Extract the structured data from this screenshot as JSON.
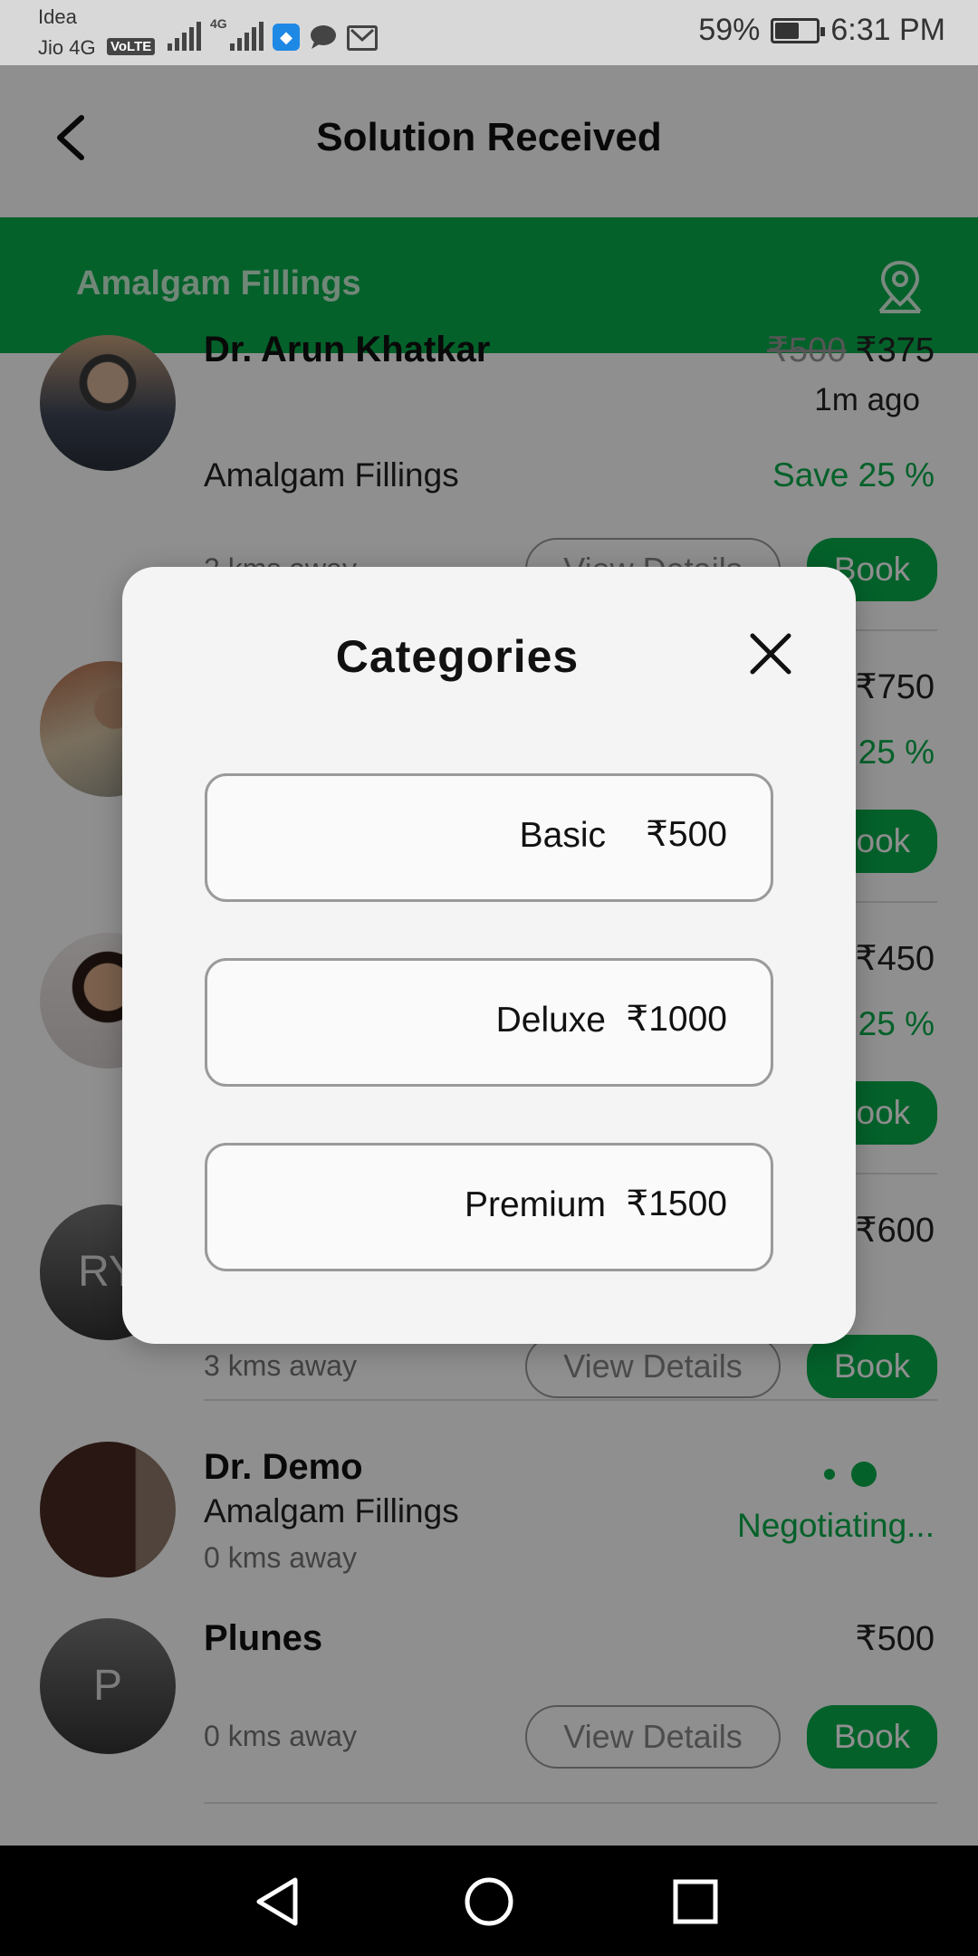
{
  "status_bar": {
    "carrier1": "Idea",
    "carrier2": "Jio 4G",
    "volte": "VoLTE",
    "net_type": "4G",
    "battery_level": 0.59,
    "battery_text": "59%",
    "time": "6:31 PM"
  },
  "header": {
    "title": "Solution Received"
  },
  "service_bar": {
    "service": "Amalgam Fillings"
  },
  "list": {
    "time_ago": "1m ago",
    "items": [
      {
        "name": "Dr. Arun Khatkar",
        "service": "Amalgam Fillings",
        "distance": "2 kms away",
        "old_price": "₹500",
        "price": "₹375",
        "save": "Save 25 %",
        "view_label": "View Details",
        "book_label": "Book"
      },
      {
        "price": "₹750",
        "save": "Save 25 %",
        "book_label": "Book"
      },
      {
        "price": "₹450",
        "save": "Save 25 %",
        "book_label": "Book"
      },
      {
        "initials": "RY",
        "price": "₹600",
        "distance": "3 kms away",
        "view_label": "View Details",
        "book_label": "Book"
      },
      {
        "name": "Dr. Demo",
        "service": "Amalgam Fillings",
        "distance": "0 kms away",
        "status": "Negotiating..."
      },
      {
        "initials": "P",
        "name": "Plunes",
        "price": "₹500",
        "distance": "0 kms away",
        "view_label": "View Details",
        "book_label": "Book"
      }
    ]
  },
  "modal": {
    "title": "Categories",
    "categories": [
      {
        "name": "Basic",
        "price": "₹500"
      },
      {
        "name": "Deluxe",
        "price": "₹1000"
      },
      {
        "name": "Premium",
        "price": "₹1500"
      }
    ]
  },
  "icons": {
    "accent": "#08ad4b"
  }
}
